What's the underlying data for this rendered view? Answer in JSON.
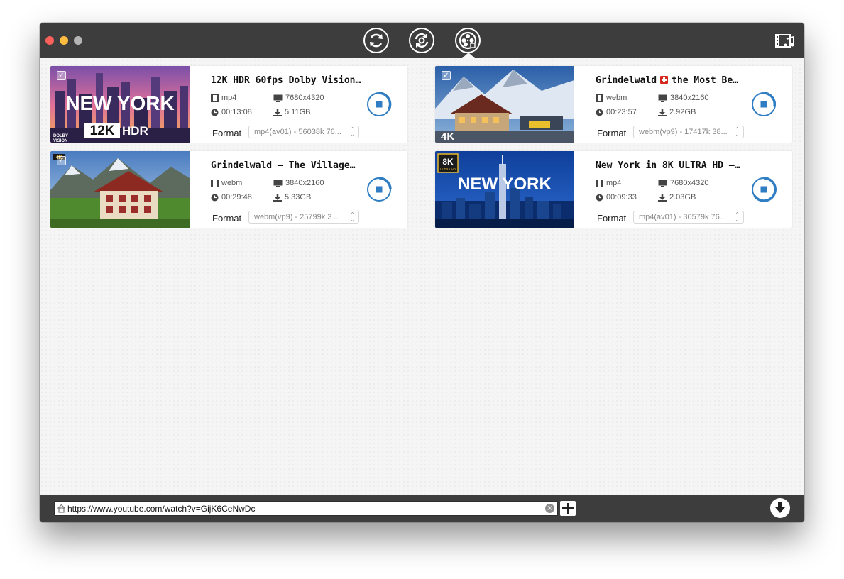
{
  "window": {
    "toolbar": {
      "buttons": [
        {
          "name": "refresh-icon",
          "label": ""
        },
        {
          "name": "convert-icon",
          "label": ""
        },
        {
          "name": "film-reel-icon",
          "label": ""
        }
      ],
      "active": "film-reel-icon",
      "right_icon": "media-library-icon"
    }
  },
  "videos": [
    {
      "title": "12K HDR 60fps Dolby Vision…",
      "title_flag": false,
      "title_suffix": "",
      "thumbnail": {
        "overlay_text": "NEW YORK",
        "badge": "12K HDR",
        "corner_logo": "DOLBY VISION",
        "checked": true
      },
      "ext": "mp4",
      "resolution": "7680x4320",
      "duration": "00:13:08",
      "size": "5.11GB",
      "format_label": "Format",
      "format_value": "mp4(av01) - 56038k 76..."
    },
    {
      "title": "Grindelwald",
      "title_flag": true,
      "title_suffix": "the Most Be…",
      "thumbnail": {
        "overlay_text": "",
        "badge": "4K",
        "corner_logo": "",
        "checked": true
      },
      "ext": "webm",
      "resolution": "3840x2160",
      "duration": "00:23:57",
      "size": "2.92GB",
      "format_label": "Format",
      "format_value": "webm(vp9) - 17417k 38..."
    },
    {
      "title": "Grindelwald – The Village…",
      "title_flag": false,
      "title_suffix": "",
      "thumbnail": {
        "overlay_text": "",
        "badge": "4K",
        "corner_logo": "",
        "checked": true
      },
      "ext": "webm",
      "resolution": "3840x2160",
      "duration": "00:29:48",
      "size": "5.33GB",
      "format_label": "Format",
      "format_value": "webm(vp9) - 25799k 3..."
    },
    {
      "title": "New York in 8K ULTRA HD –…",
      "title_flag": false,
      "title_suffix": "",
      "thumbnail": {
        "overlay_text": "NEW YORK",
        "badge": "8K",
        "corner_logo": "ULTRA HD",
        "checked": false
      },
      "ext": "mp4",
      "resolution": "7680x4320",
      "duration": "00:09:33",
      "size": "2.03GB",
      "format_label": "Format",
      "format_value": "mp4(av01) - 30579k 76..."
    }
  ],
  "bottom_bar": {
    "url_value": "https://www.youtube.com/watch?v=GijK6CeNwDc",
    "clear_icon": "clear-icon",
    "add_icon": "plus-icon",
    "download_all_icon": "download-arrow-icon"
  },
  "colors": {
    "titlebar": "#3d3d3d",
    "accent": "#2f7dc2",
    "content_bg": "#f5f5f5"
  }
}
